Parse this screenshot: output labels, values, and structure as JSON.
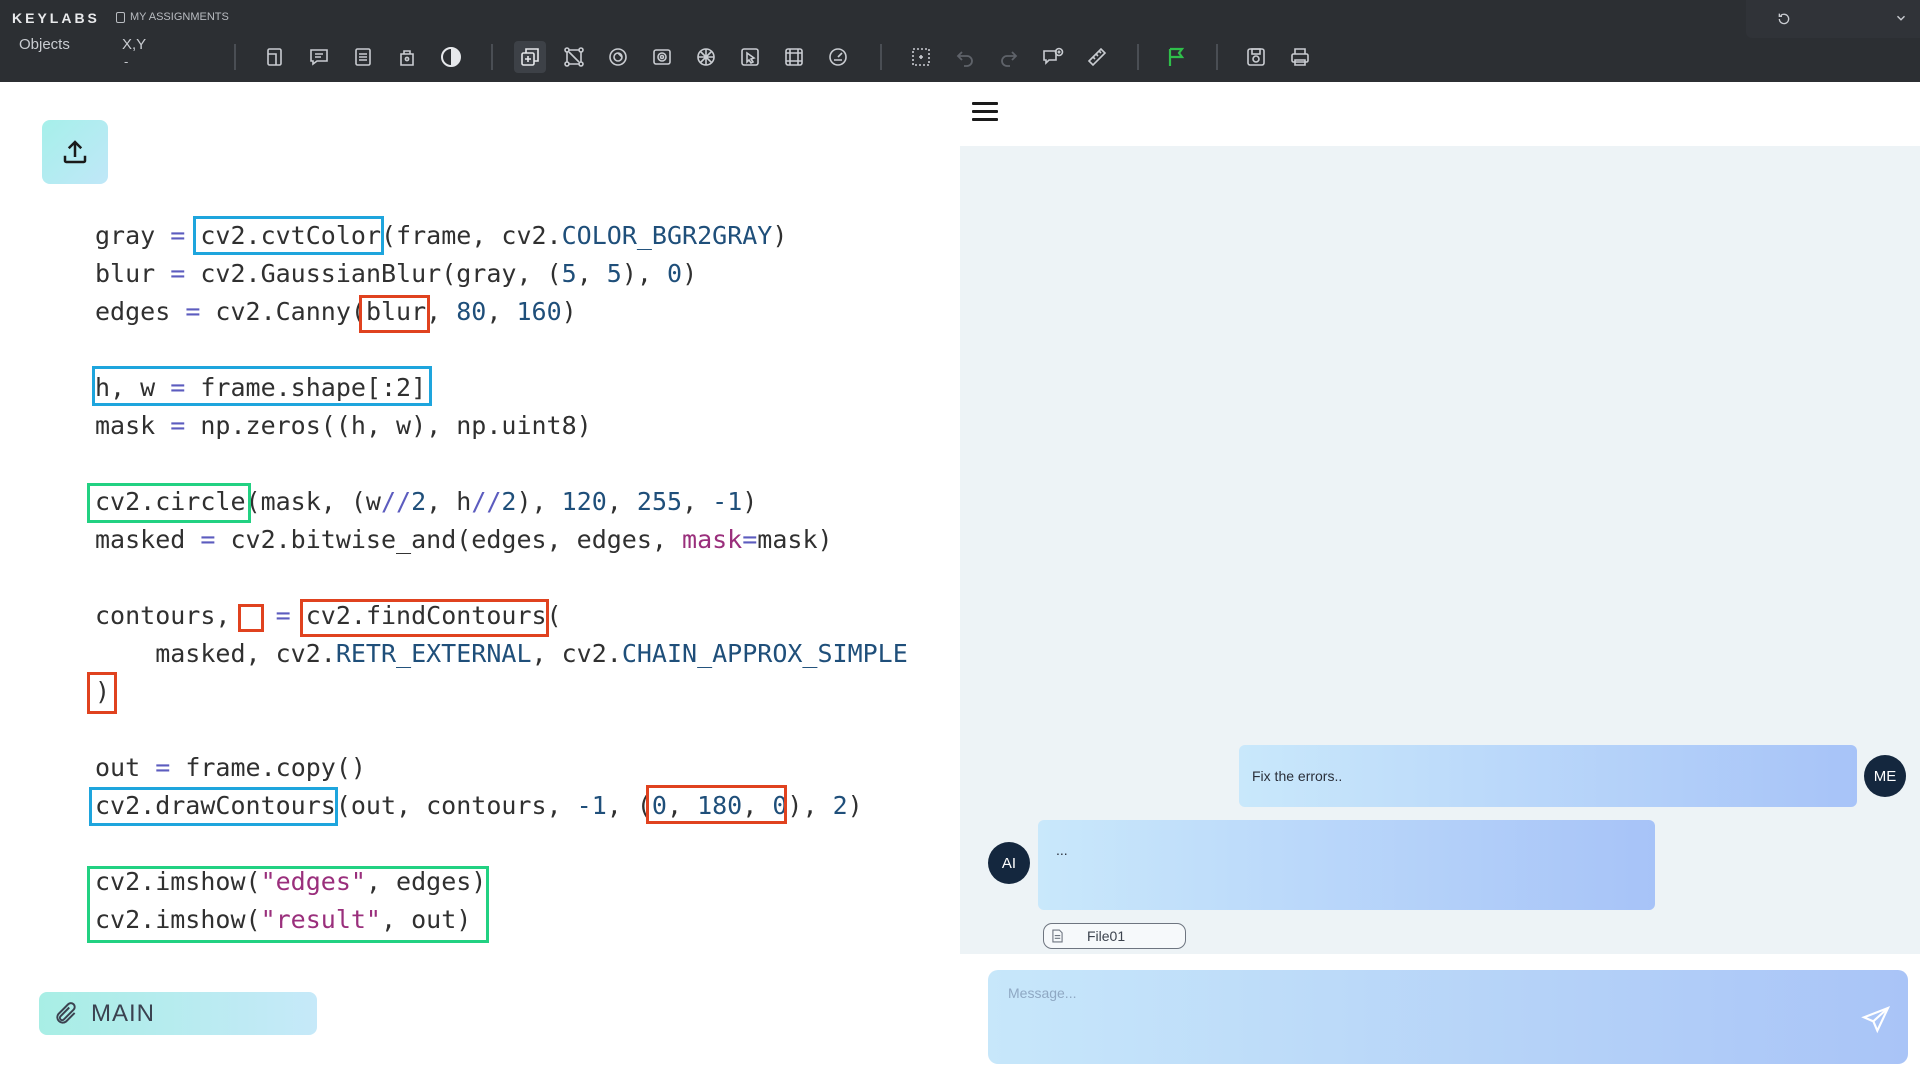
{
  "app": {
    "brand": "KEYLABS",
    "assignments_label": "MY ASSIGNMENTS",
    "objects_label": "Objects",
    "xy_label": "X,Y",
    "xy_value": "-"
  },
  "toolbar": {
    "icons": [
      "page-icon",
      "notes-icon",
      "list-icon",
      "bag-icon",
      "contrast-icon",
      "layers-icon",
      "nodes-icon",
      "target-icon",
      "radial-icon",
      "grid-circle-icon",
      "cursor-box-icon",
      "frame-icon",
      "dial-icon",
      "select-box-icon",
      "undo-icon",
      "redo-icon",
      "comment-icon",
      "ruler-icon",
      "flag-icon",
      "save-icon",
      "print-icon"
    ],
    "active_icon": "layers-icon",
    "flag_color": "#2fbf4a"
  },
  "editor": {
    "code_lines": [
      [
        {
          "t": "gray ",
          "c": ""
        },
        {
          "t": "=",
          "c": "op"
        },
        {
          "t": " cv2.cvtColor(frame, cv2.",
          "c": ""
        },
        {
          "t": "COLOR_BGR2GRAY",
          "c": "kw"
        },
        {
          "t": ")",
          "c": ""
        }
      ],
      [
        {
          "t": "blur ",
          "c": ""
        },
        {
          "t": "=",
          "c": "op"
        },
        {
          "t": " cv2.GaussianBlur(gray, (",
          "c": ""
        },
        {
          "t": "5",
          "c": "num"
        },
        {
          "t": ", ",
          "c": ""
        },
        {
          "t": "5",
          "c": "num"
        },
        {
          "t": "), ",
          "c": ""
        },
        {
          "t": "0",
          "c": "num"
        },
        {
          "t": ")",
          "c": ""
        }
      ],
      [
        {
          "t": "edges ",
          "c": ""
        },
        {
          "t": "=",
          "c": "op"
        },
        {
          "t": " cv2.Canny(blur, ",
          "c": ""
        },
        {
          "t": "80",
          "c": "num"
        },
        {
          "t": ", ",
          "c": ""
        },
        {
          "t": "160",
          "c": "num"
        },
        {
          "t": ")",
          "c": ""
        }
      ],
      [],
      [
        {
          "t": "h, w ",
          "c": ""
        },
        {
          "t": "=",
          "c": "op"
        },
        {
          "t": " frame.shape[:2]",
          "c": ""
        }
      ],
      [
        {
          "t": "mask ",
          "c": ""
        },
        {
          "t": "=",
          "c": "op"
        },
        {
          "t": " np.zeros((h, w), np.uint8)",
          "c": ""
        }
      ],
      [],
      [
        {
          "t": "cv2.circle(mask, (w",
          "c": ""
        },
        {
          "t": "//",
          "c": "op"
        },
        {
          "t": "2",
          "c": "num"
        },
        {
          "t": ", h",
          "c": ""
        },
        {
          "t": "//",
          "c": "op"
        },
        {
          "t": "2",
          "c": "num"
        },
        {
          "t": "), ",
          "c": ""
        },
        {
          "t": "120",
          "c": "num"
        },
        {
          "t": ", ",
          "c": ""
        },
        {
          "t": "255",
          "c": "num"
        },
        {
          "t": ", ",
          "c": ""
        },
        {
          "t": "-1",
          "c": "num"
        },
        {
          "t": ")",
          "c": ""
        }
      ],
      [
        {
          "t": "masked ",
          "c": ""
        },
        {
          "t": "=",
          "c": "op"
        },
        {
          "t": " cv2.bitwise_and(edges, edges, ",
          "c": ""
        },
        {
          "t": "mask",
          "c": "mg"
        },
        {
          "t": "=",
          "c": "op"
        },
        {
          "t": "mask)",
          "c": ""
        }
      ],
      [],
      [
        {
          "t": "contours, _ ",
          "c": ""
        },
        {
          "t": "=",
          "c": "op"
        },
        {
          "t": " cv2.findContours(",
          "c": ""
        }
      ],
      [
        {
          "t": "    masked, cv2.",
          "c": ""
        },
        {
          "t": "RETR_EXTERNAL",
          "c": "kw"
        },
        {
          "t": ", cv2.",
          "c": ""
        },
        {
          "t": "CHAIN_APPROX_SIMPLE",
          "c": "kw"
        }
      ],
      [
        {
          "t": ")",
          "c": ""
        }
      ],
      [],
      [
        {
          "t": "out ",
          "c": ""
        },
        {
          "t": "=",
          "c": "op"
        },
        {
          "t": " frame.copy()",
          "c": ""
        }
      ],
      [
        {
          "t": "cv2.drawContours(out, contours, ",
          "c": ""
        },
        {
          "t": "-1",
          "c": "num"
        },
        {
          "t": ", (",
          "c": ""
        },
        {
          "t": "0",
          "c": "num"
        },
        {
          "t": ", ",
          "c": ""
        },
        {
          "t": "180",
          "c": "num"
        },
        {
          "t": ", ",
          "c": ""
        },
        {
          "t": "0",
          "c": "num"
        },
        {
          "t": "), ",
          "c": ""
        },
        {
          "t": "2",
          "c": "num"
        },
        {
          "t": ")",
          "c": ""
        }
      ],
      [],
      [
        {
          "t": "cv2.imshow(",
          "c": ""
        },
        {
          "t": "\"edges\"",
          "c": "str"
        },
        {
          "t": ", edges)",
          "c": ""
        }
      ],
      [
        {
          "t": "cv2.imshow(",
          "c": ""
        },
        {
          "t": "\"result\"",
          "c": "str"
        },
        {
          "t": ", out)",
          "c": ""
        }
      ]
    ],
    "highlight_colors": {
      "blue": "#1ea5dd",
      "red": "#e0421f",
      "green": "#22d182"
    },
    "branch_label": "MAIN"
  },
  "chat": {
    "messages": [
      {
        "sender": "ME",
        "text": "Fix the errors.."
      },
      {
        "sender": "AI",
        "text": "..."
      }
    ],
    "attachment": "File01",
    "composer_placeholder": "Message..."
  }
}
